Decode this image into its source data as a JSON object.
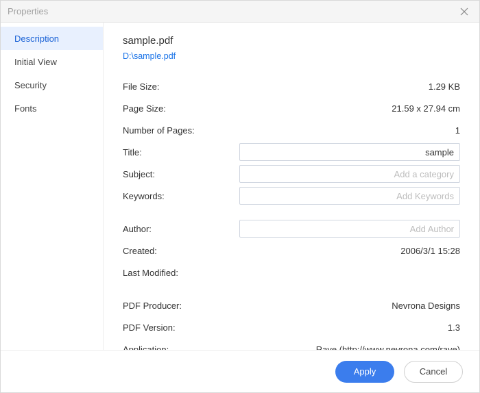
{
  "window": {
    "title": "Properties"
  },
  "sidebar": {
    "items": [
      {
        "label": "Description",
        "active": true
      },
      {
        "label": "Initial View",
        "active": false
      },
      {
        "label": "Security",
        "active": false
      },
      {
        "label": "Fonts",
        "active": false
      }
    ]
  },
  "content": {
    "filename": "sample.pdf",
    "filepath": "D:\\sample.pdf",
    "labels": {
      "file_size": "File Size:",
      "page_size": "Page Size:",
      "num_pages": "Number of Pages:",
      "title": "Title:",
      "subject": "Subject:",
      "keywords": "Keywords:",
      "author": "Author:",
      "created": "Created:",
      "last_modified": "Last Modified:",
      "pdf_producer": "PDF Producer:",
      "pdf_version": "PDF Version:",
      "application": "Application:"
    },
    "values": {
      "file_size": "1.29 KB",
      "page_size": "21.59 x 27.94 cm",
      "num_pages": "1",
      "title": "sample",
      "subject": "",
      "keywords": "",
      "author": "",
      "created": "2006/3/1 15:28",
      "last_modified": "",
      "pdf_producer": "Nevrona Designs",
      "pdf_version": "1.3",
      "application": "Rave (http://www.nevrona.com/rave)"
    },
    "placeholders": {
      "subject": "Add a category",
      "keywords": "Add Keywords",
      "author": "Add Author"
    }
  },
  "footer": {
    "apply_label": "Apply",
    "cancel_label": "Cancel"
  }
}
